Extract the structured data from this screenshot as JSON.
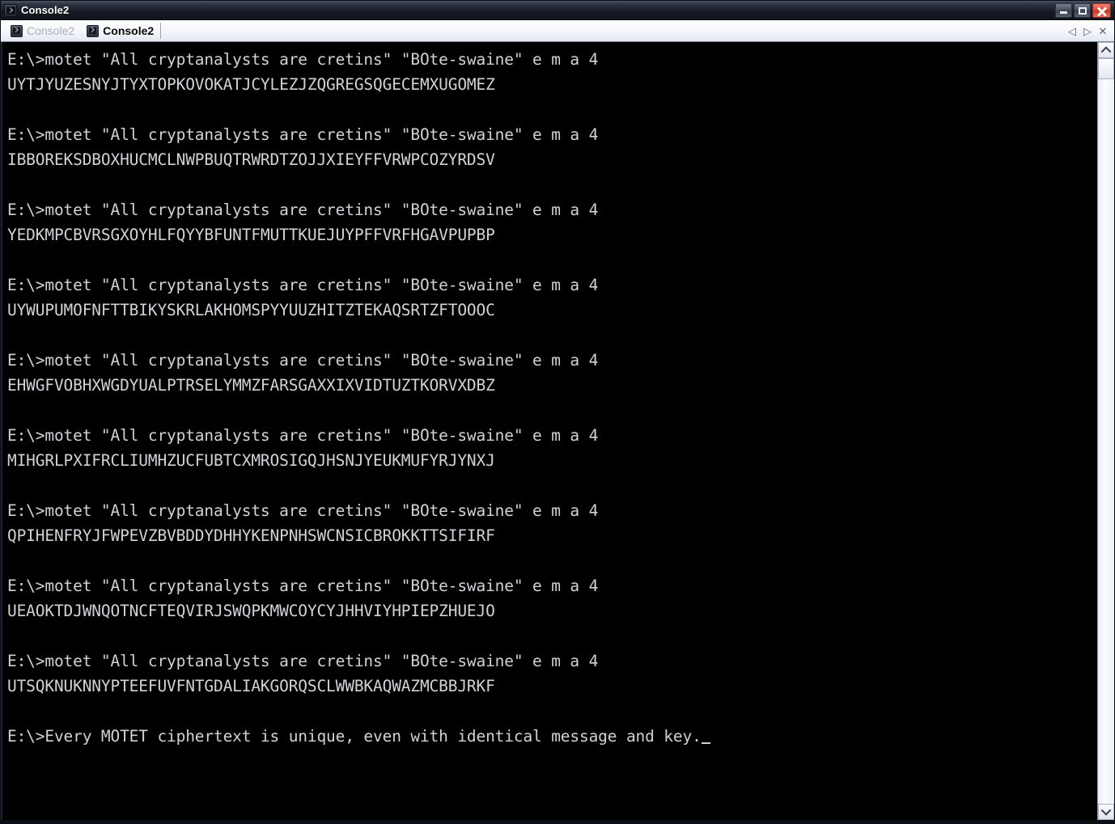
{
  "window": {
    "title": "Console2",
    "icon": "console-icon",
    "caption_buttons": [
      {
        "name": "minimize-button",
        "glyph": "minimize-icon",
        "label": "Minimize"
      },
      {
        "name": "maximize-button",
        "glyph": "maximize-icon",
        "label": "Maximize"
      },
      {
        "name": "close-button",
        "glyph": "close-icon",
        "label": "Close"
      }
    ]
  },
  "tabbar": {
    "tabs": [
      {
        "label": "Console2",
        "active": false,
        "icon": "console-icon"
      },
      {
        "label": "Console2",
        "active": true,
        "icon": "console-icon"
      }
    ],
    "tools": [
      {
        "name": "tab-prev-button",
        "glyph": "◁"
      },
      {
        "name": "tab-next-button",
        "glyph": "▷"
      },
      {
        "name": "tab-close-button",
        "glyph": "✕"
      }
    ]
  },
  "console": {
    "prompt": "E:\\>",
    "command": "motet \"All cryptanalysts are cretins\" \"BOte-swaine\" e m a 4",
    "cursor": "_",
    "lines": [
      {
        "type": "command",
        "text": "E:\\>motet \"All cryptanalysts are cretins\" \"BOte-swaine\" e m a 4"
      },
      {
        "type": "output",
        "text": "UYTJYUZESNYJTYXTOPKOVOKATJCYLEZJZQGREGSQGECEMXUGOMEZ"
      },
      {
        "type": "blank",
        "text": " "
      },
      {
        "type": "command",
        "text": "E:\\>motet \"All cryptanalysts are cretins\" \"BOte-swaine\" e m a 4"
      },
      {
        "type": "output",
        "text": "IBBOREKSDBOXHUCMCLNWPBUQTRWRDTZOJJXIEYFFVRWPCOZYRDSV"
      },
      {
        "type": "blank",
        "text": " "
      },
      {
        "type": "command",
        "text": "E:\\>motet \"All cryptanalysts are cretins\" \"BOte-swaine\" e m a 4"
      },
      {
        "type": "output",
        "text": "YEDKMPCBVRSGXOYHLFQYYBFUNTFMUTTKUEJUYPFFVRFHGAVPUPBP"
      },
      {
        "type": "blank",
        "text": " "
      },
      {
        "type": "command",
        "text": "E:\\>motet \"All cryptanalysts are cretins\" \"BOte-swaine\" e m a 4"
      },
      {
        "type": "output",
        "text": "UYWUPUMOFNFTTBIKYSKRLAKHOMSPYYUUZHITZTEKAQSRTZFTOOOC"
      },
      {
        "type": "blank",
        "text": " "
      },
      {
        "type": "command",
        "text": "E:\\>motet \"All cryptanalysts are cretins\" \"BOte-swaine\" e m a 4"
      },
      {
        "type": "output",
        "text": "EHWGFVOBHXWGDYUALPTRSELYMMZFARSGAXXIXVIDTUZTKORVXDBZ"
      },
      {
        "type": "blank",
        "text": " "
      },
      {
        "type": "command",
        "text": "E:\\>motet \"All cryptanalysts are cretins\" \"BOte-swaine\" e m a 4"
      },
      {
        "type": "output",
        "text": "MIHGRLPXIFRCLIUMHZUCFUBTCXMROSIGQJHSNJYEUKMUFYRJYNXJ"
      },
      {
        "type": "blank",
        "text": " "
      },
      {
        "type": "command",
        "text": "E:\\>motet \"All cryptanalysts are cretins\" \"BOte-swaine\" e m a 4"
      },
      {
        "type": "output",
        "text": "QPIHENFRYJFWPEVZBVBDDYDHHYKENPNHSWCNSICBROKKTTSIFIRF"
      },
      {
        "type": "blank",
        "text": " "
      },
      {
        "type": "command",
        "text": "E:\\>motet \"All cryptanalysts are cretins\" \"BOte-swaine\" e m a 4"
      },
      {
        "type": "output",
        "text": "UEAOKTDJWNQOTNCFTEQVIRJSWQPKMWCOYCYJHHVIYHPIEPZHUEJO"
      },
      {
        "type": "blank",
        "text": " "
      },
      {
        "type": "command",
        "text": "E:\\>motet \"All cryptanalysts are cretins\" \"BOte-swaine\" e m a 4"
      },
      {
        "type": "output",
        "text": "UTSQKNUKNNYPTEEFUVFNTGDALIAKGORQSCLWWBKAQWAZMCBBJRKF"
      },
      {
        "type": "blank",
        "text": " "
      },
      {
        "type": "prompt-final",
        "text": "E:\\>Every MOTET ciphertext is unique, even with identical message and key."
      }
    ]
  },
  "scrollbar": {
    "up_glyph": "scroll-up-icon",
    "down_glyph": "scroll-down-icon",
    "thumb_position_percent": 0
  },
  "colors": {
    "console_background": "#000000",
    "console_text": "#cfd3d8",
    "titlebar_dark": "#171c27",
    "close_button_red": "#d84a37",
    "tabbar_background": "#f4f6fa",
    "active_tab_text": "#0a0a0a",
    "inactive_tab_text": "#a7adb9"
  }
}
